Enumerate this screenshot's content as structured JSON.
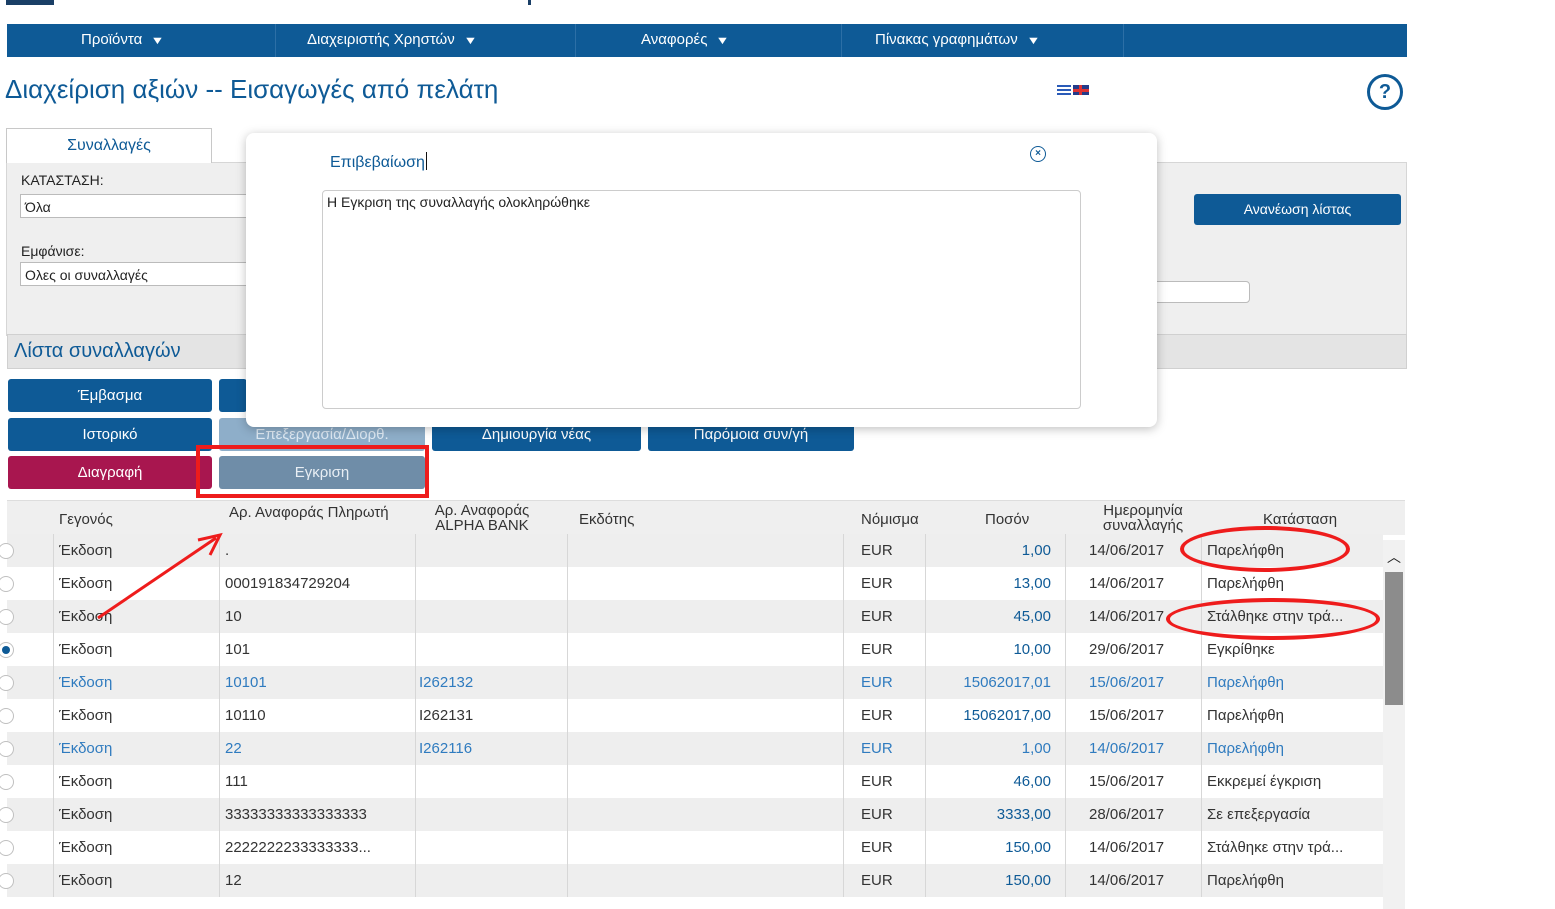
{
  "nav": {
    "items": [
      {
        "label": "Προϊόντα"
      },
      {
        "label": "Διαχειριστής Χρηστών"
      },
      {
        "label": "Αναφορές"
      },
      {
        "label": "Πίνακας γραφημάτων"
      }
    ]
  },
  "page": {
    "title": "Διαχείριση αξιών -- Εισαγωγές από πελάτη",
    "help_glyph": "?"
  },
  "filters": {
    "tab_label": "Συναλλαγές",
    "status_label": "ΚΑΤΑΣΤΑΣΗ:",
    "status_value": "Όλα",
    "show_label": "Εμφάνισε:",
    "show_value": "Ολες οι συναλλαγές",
    "refresh_label": "Ανανέωση λίστας"
  },
  "list": {
    "title": "Λίστα συναλλαγών",
    "buttons": {
      "remittance": "Έμβασμα",
      "history": "Ιστορικό",
      "edit": "Επεξεργασία/Διορθ.",
      "create": "Δημιουργία νέας",
      "similar": "Παρόμοια συν/γή",
      "delete": "Διαγραφή",
      "approve": "Εγκριση"
    }
  },
  "table": {
    "headers": {
      "event": "Γεγονός",
      "payer_ref": "Αρ. Αναφοράς Πληρωτή",
      "bank_ref_1": "Αρ. Αναφοράς",
      "bank_ref_2": "ALPHA BANK",
      "issuer": "Εκδότης",
      "currency": "Νόμισμα",
      "amount": "Ποσόν",
      "date_1": "Ημερομηνία",
      "date_2": "συναλλαγής",
      "status": "Κατάσταση"
    },
    "rows": [
      {
        "event": "Έκδοση",
        "payer_ref": ".",
        "bank_ref": "",
        "issuer": "",
        "currency": "EUR",
        "amount": "1,00",
        "date": "14/06/2017",
        "status": "Παρελήφθη"
      },
      {
        "event": "Έκδοση",
        "payer_ref": "000191834729204",
        "bank_ref": "",
        "issuer": "",
        "currency": "EUR",
        "amount": "13,00",
        "date": "14/06/2017",
        "status": "Παρελήφθη"
      },
      {
        "event": "Έκδοση",
        "payer_ref": "10",
        "bank_ref": "",
        "issuer": "",
        "currency": "EUR",
        "amount": "45,00",
        "date": "14/06/2017",
        "status": "Στάλθηκε στην τρά..."
      },
      {
        "event": "Έκδοση",
        "payer_ref": "101",
        "bank_ref": "",
        "issuer": "",
        "currency": "EUR",
        "amount": "10,00",
        "date": "29/06/2017",
        "status": "Εγκρίθηκε"
      },
      {
        "event": "Έκδοση",
        "payer_ref": "10101",
        "bank_ref": "I262132",
        "issuer": "",
        "currency": "EUR",
        "amount": "15062017,01",
        "date": "15/06/2017",
        "status": "Παρελήφθη"
      },
      {
        "event": "Έκδοση",
        "payer_ref": "10110",
        "bank_ref": "I262131",
        "issuer": "",
        "currency": "EUR",
        "amount": "15062017,00",
        "date": "15/06/2017",
        "status": "Παρελήφθη"
      },
      {
        "event": "Έκδοση",
        "payer_ref": "22",
        "bank_ref": "I262116",
        "issuer": "",
        "currency": "EUR",
        "amount": "1,00",
        "date": "14/06/2017",
        "status": "Παρελήφθη"
      },
      {
        "event": "Έκδοση",
        "payer_ref": "111",
        "bank_ref": "",
        "issuer": "",
        "currency": "EUR",
        "amount": "46,00",
        "date": "15/06/2017",
        "status": "Εκκρεμεί έγκριση"
      },
      {
        "event": "Έκδοση",
        "payer_ref": "33333333333333333",
        "bank_ref": "",
        "issuer": "",
        "currency": "EUR",
        "amount": "3333,00",
        "date": "28/06/2017",
        "status": "Σε επεξεργασία"
      },
      {
        "event": "Έκδοση",
        "payer_ref": "2222222233333333...",
        "bank_ref": "",
        "issuer": "",
        "currency": "EUR",
        "amount": "150,00",
        "date": "14/06/2017",
        "status": "Στάλθηκε στην τρά..."
      },
      {
        "event": "Έκδοση",
        "payer_ref": "12",
        "bank_ref": "",
        "issuer": "",
        "currency": "EUR",
        "amount": "150,00",
        "date": "14/06/2017",
        "status": "Παρελήφθη"
      }
    ],
    "selected_row": 3,
    "link_rows": [
      4,
      6
    ]
  },
  "modal": {
    "title": "Επιβεβαίωση",
    "message": "Η Εγκριση της συναλλαγής ολοκληρώθηκε",
    "close_glyph": "×"
  },
  "colors": {
    "brand": "#0e5a96",
    "danger": "#a8164f",
    "annotation": "#ee1c1c"
  }
}
